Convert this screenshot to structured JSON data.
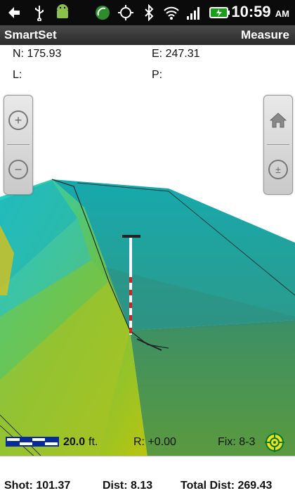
{
  "status_bar": {
    "time": "10:59",
    "ampm": "AM",
    "icons": [
      "usb-icon",
      "android-icon",
      "gps-icon",
      "bluetooth-icon",
      "wifi-icon",
      "signal-icon",
      "battery-icon"
    ]
  },
  "title_bar": {
    "app_name": "SmartSet",
    "mode": "Measure"
  },
  "coords": {
    "north": "N: 175.93",
    "east": "E: 247.31",
    "l_label": "L:",
    "p_label": "P:"
  },
  "map": {
    "scale_value": "20.0",
    "scale_unit": "ft.",
    "rotation": "R: +0.00",
    "fix": "Fix: 8-3"
  },
  "footer": {
    "shot": "Shot: 101.37",
    "dist": "Dist: 8.13",
    "total_dist": "Total Dist: 269.43"
  },
  "colors": {
    "terrain_top": "#13a3a8",
    "terrain_mid": "#4f9a4d",
    "terrain_bottom": "#b6c212",
    "accent": "#0a7a2a"
  }
}
